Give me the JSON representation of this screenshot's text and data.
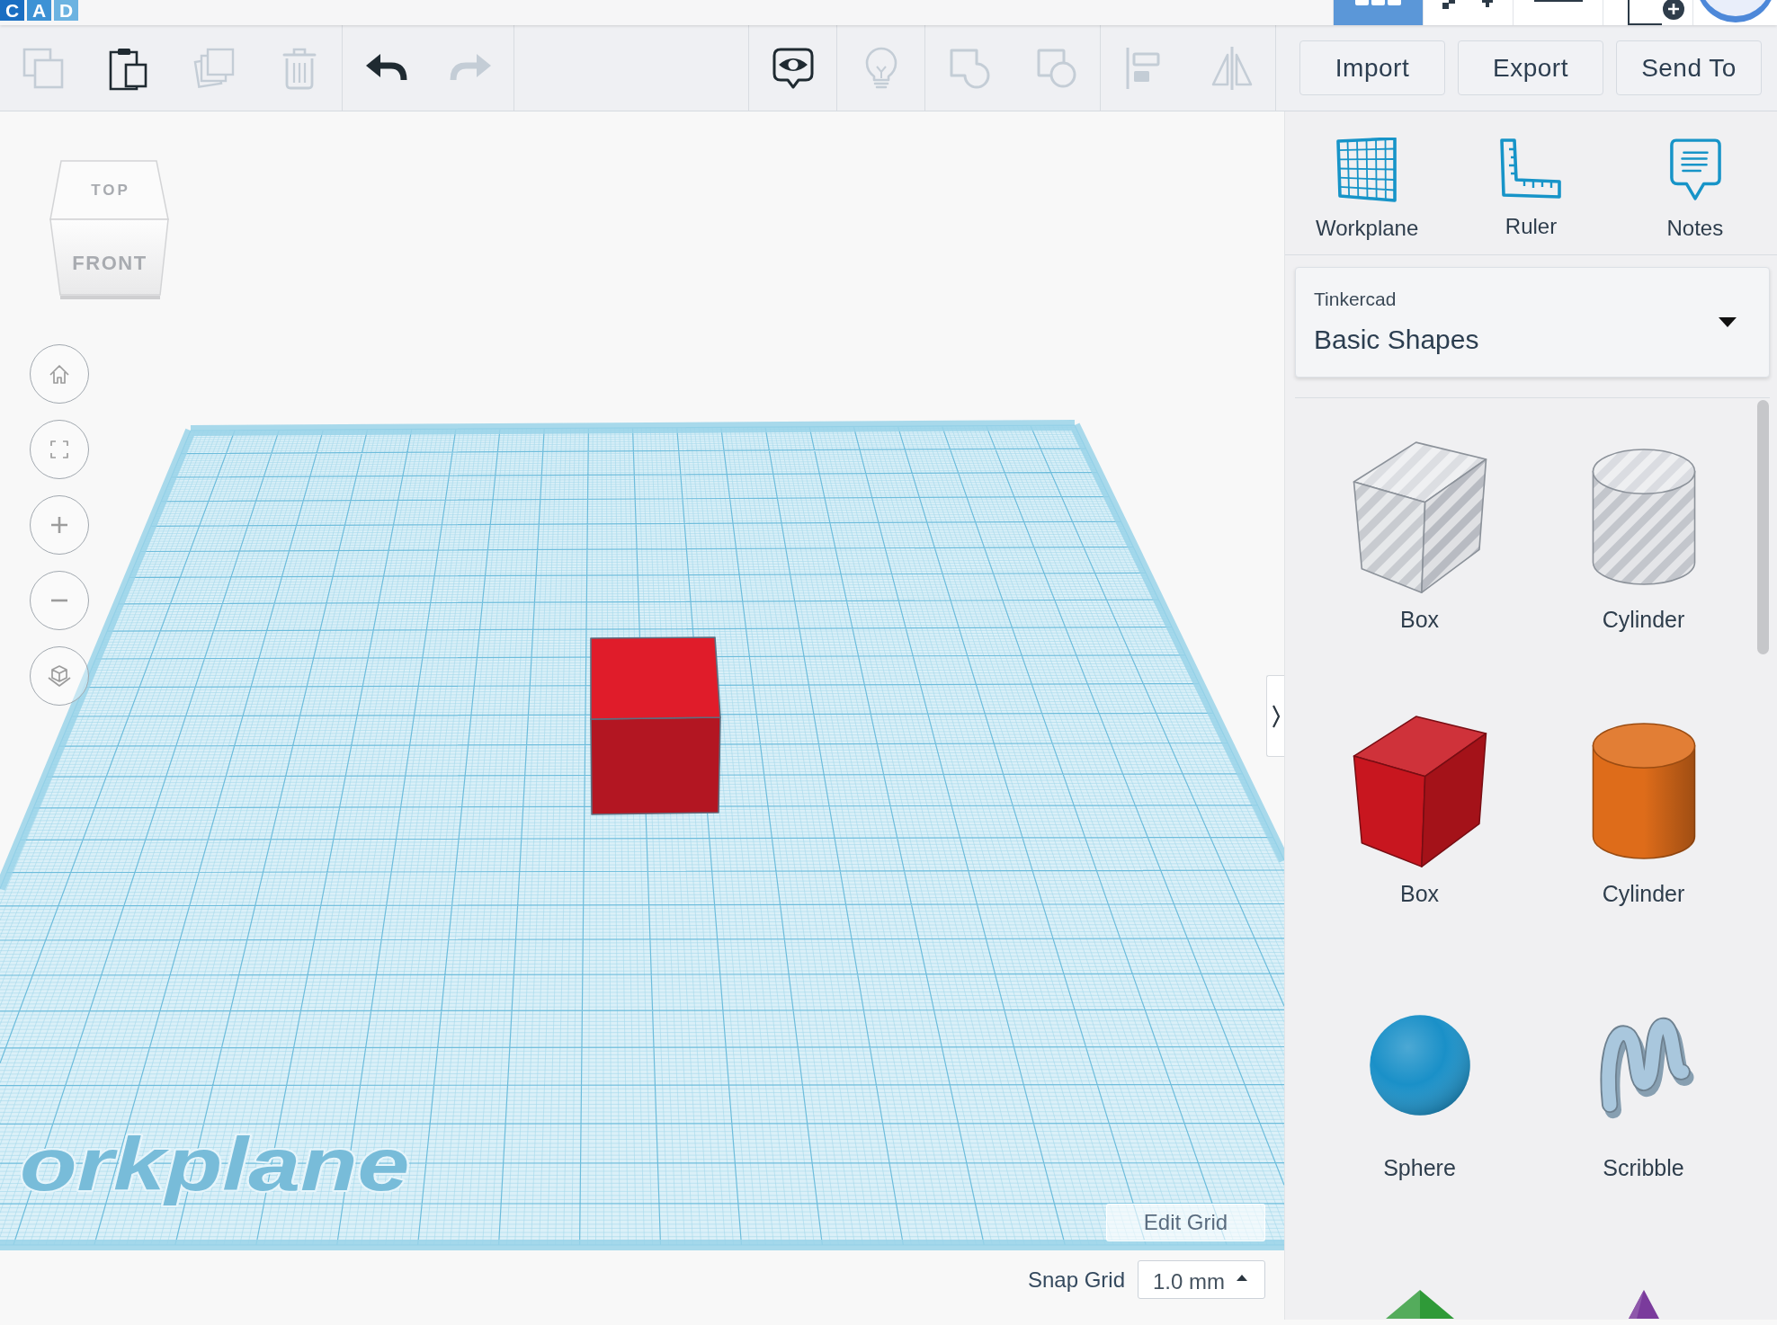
{
  "header": {
    "logo": [
      {
        "letter": "C",
        "color": "#1a6ec2"
      },
      {
        "letter": "A",
        "color": "#3d92d5"
      },
      {
        "letter": "D",
        "color": "#6cb3e1"
      }
    ],
    "view_modes": [
      {
        "kind": "grid",
        "selected": true
      },
      {
        "kind": "blocks",
        "selected": false
      },
      {
        "kind": "lines",
        "selected": false
      }
    ]
  },
  "toolbar": {
    "left_groups": [
      [
        {
          "kind": "copy",
          "disabled": true
        },
        {
          "kind": "paste",
          "disabled": false
        },
        {
          "kind": "duplicate",
          "disabled": true
        },
        {
          "kind": "delete",
          "disabled": true
        }
      ],
      [
        {
          "kind": "undo",
          "disabled": false
        },
        {
          "kind": "redo",
          "disabled": true
        }
      ]
    ],
    "right_groups": [
      [
        {
          "kind": "notes",
          "disabled": false
        }
      ],
      [
        {
          "kind": "hint",
          "disabled": true
        }
      ],
      [
        {
          "kind": "group",
          "disabled": true
        },
        {
          "kind": "ungroup",
          "disabled": true
        }
      ],
      [
        {
          "kind": "align",
          "disabled": true
        },
        {
          "kind": "mirror",
          "disabled": true
        }
      ]
    ],
    "buttons": [
      "Import",
      "Export",
      "Send To"
    ]
  },
  "viewport": {
    "view_cube": {
      "top": "TOP",
      "front": "FRONT"
    },
    "nav_controls": [
      {
        "kind": "home"
      },
      {
        "kind": "fit"
      },
      {
        "kind": "zoom_in"
      },
      {
        "kind": "zoom_out"
      },
      {
        "kind": "perspective"
      }
    ],
    "objects": [
      {
        "kind": "box",
        "color": "#e01c2a"
      }
    ],
    "workplane_label": "orkplane",
    "edit_grid": "Edit Grid",
    "snap_grid": {
      "label": "Snap Grid",
      "value": "1.0 mm"
    }
  },
  "panel": {
    "tools": [
      {
        "kind": "workplane",
        "label": "Workplane"
      },
      {
        "kind": "ruler",
        "label": "Ruler"
      },
      {
        "kind": "notes",
        "label": "Notes"
      }
    ],
    "library": {
      "label": "Tinkercad",
      "value": "Basic Shapes"
    },
    "shapes": [
      {
        "label": "Box",
        "kind": "box",
        "hole": true
      },
      {
        "label": "Cylinder",
        "kind": "cylinder",
        "hole": true
      },
      {
        "label": "Box",
        "kind": "box",
        "hole": false,
        "color": "#c8161f"
      },
      {
        "label": "Cylinder",
        "kind": "cylinder",
        "hole": false,
        "color": "#de6c1a"
      },
      {
        "label": "Sphere",
        "kind": "sphere",
        "hole": false,
        "color": "#1a90c8"
      },
      {
        "label": "Scribble",
        "kind": "scribble",
        "hole": false,
        "color": "#a9c7dd"
      },
      {
        "kind": "pyramid",
        "hole": false,
        "color": "#2f9a38"
      },
      {
        "kind": "cone",
        "hole": false,
        "color": "#7a3b9c"
      }
    ]
  }
}
